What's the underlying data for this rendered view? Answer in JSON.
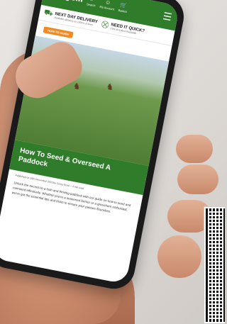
{
  "app": {
    "logo_text": "agrigem",
    "nav": [
      {
        "label": "Search",
        "icon": "search-icon"
      },
      {
        "label": "My Account",
        "icon": "account-icon"
      },
      {
        "label": "Basket",
        "icon": "basket-icon"
      }
    ],
    "menu_icon": "hamburger-icon",
    "brand_color": "#2f7d2a",
    "accent_color": "#f08a24"
  },
  "promos": [
    {
      "title": "NEXT DAY DELIVERY",
      "subtitle": "Available delivery on 1000's of lines",
      "icon": "truck-icon"
    },
    {
      "title": "NEED IT QUICK?",
      "subtitle": "Click & Collect Available",
      "icon": "cart-icon"
    }
  ],
  "article": {
    "tag": "HOW-TO GUIDE",
    "title": "How To Seed & Overseed A Paddock",
    "meta": "Published on 10th December 2023 by Corey Rose – 4 min read",
    "intro": "Unlock the secrets to a lush and thriving paddock with our guide on how to seed and overseed effectively. Whether you're a seasoned farmer or a greenhorn enthusiast, we've got the essential tips and tricks to ensure your pasture flourishes."
  }
}
